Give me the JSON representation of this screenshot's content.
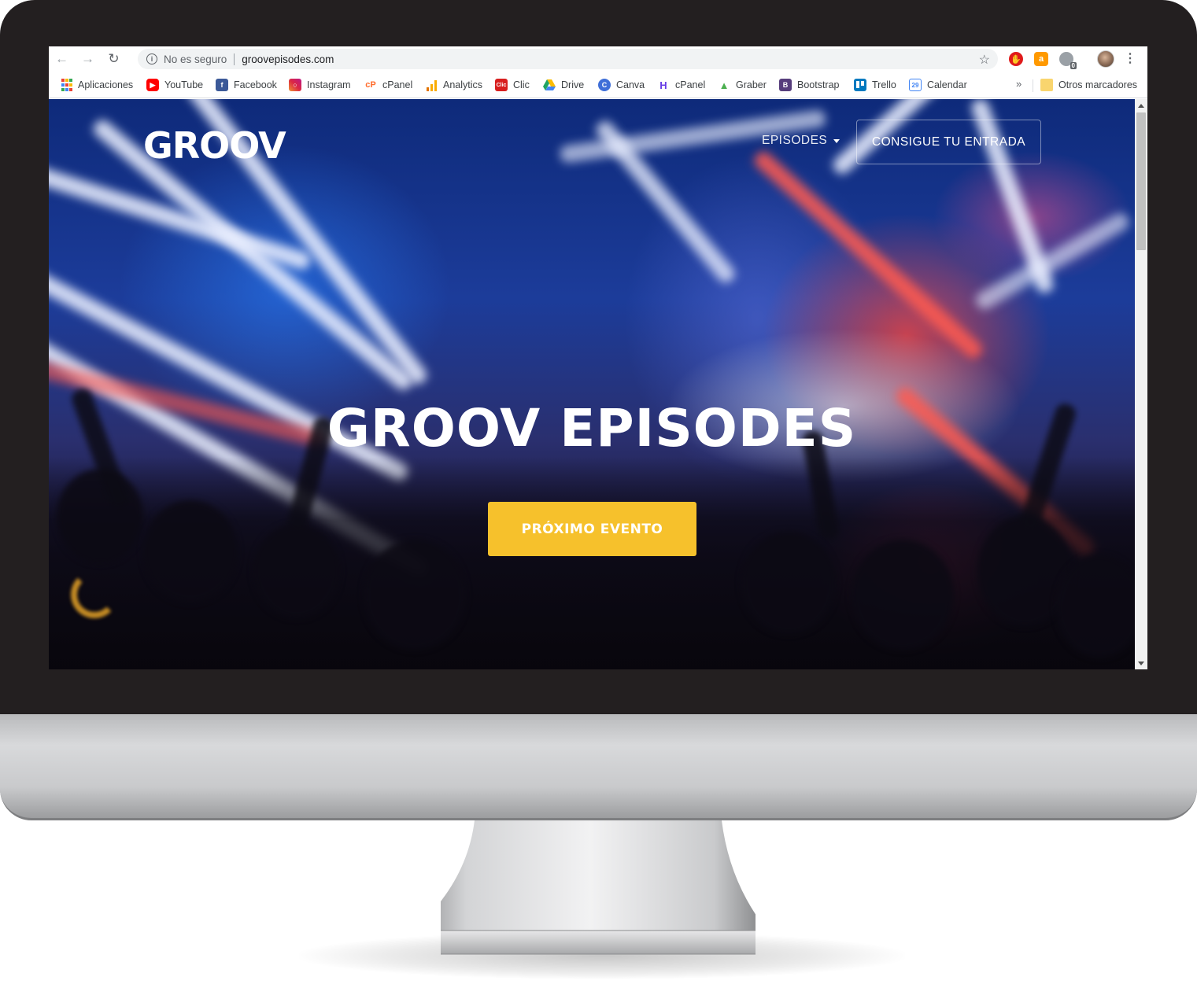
{
  "browser": {
    "security_label": "No es seguro",
    "url": "groovepisodes.com",
    "extensions": [
      "adblock-icon",
      "shopping-icon",
      "extension-icon"
    ],
    "extension_badge": "0"
  },
  "bookmarks": {
    "items": [
      {
        "label": "Aplicaciones",
        "icon": "apps-grid-icon",
        "color": "#4285f4"
      },
      {
        "label": "YouTube",
        "icon": "youtube-icon",
        "color": "#ff0000"
      },
      {
        "label": "Facebook",
        "icon": "facebook-icon",
        "color": "#3b5998"
      },
      {
        "label": "Instagram",
        "icon": "instagram-icon",
        "color": "#c13584"
      },
      {
        "label": "cPanel",
        "icon": "cpanel-icon",
        "color": "#ff6c2c"
      },
      {
        "label": "Analytics",
        "icon": "analytics-icon",
        "color": "#f9ab00"
      },
      {
        "label": "Clic",
        "icon": "clic-icon",
        "color": "#d81e1e"
      },
      {
        "label": "Drive",
        "icon": "drive-icon",
        "color": "#1fa463"
      },
      {
        "label": "Canva",
        "icon": "canva-icon",
        "color": "#3f6fd8"
      },
      {
        "label": "cPanel",
        "icon": "hostinger-icon",
        "color": "#673de6"
      },
      {
        "label": "Graber",
        "icon": "graber-icon",
        "color": "#4caf50"
      },
      {
        "label": "Bootstrap",
        "icon": "bootstrap-icon",
        "color": "#563d7c"
      },
      {
        "label": "Trello",
        "icon": "trello-icon",
        "color": "#0079bf"
      },
      {
        "label": "Calendar",
        "icon": "calendar-icon",
        "color": "#4285f4"
      }
    ],
    "calendar_day": "29",
    "more_label": "»",
    "other_label": "Otros marcadores"
  },
  "site": {
    "logo": "GROOV",
    "nav_episodes": "EPISODES",
    "nav_ticket": "CONSIGUE TU ENTRADA",
    "hero_title": "GROOV EPISODES",
    "hero_cta": "PRÓXIMO EVENTO",
    "accent_color": "#f6c12c"
  }
}
